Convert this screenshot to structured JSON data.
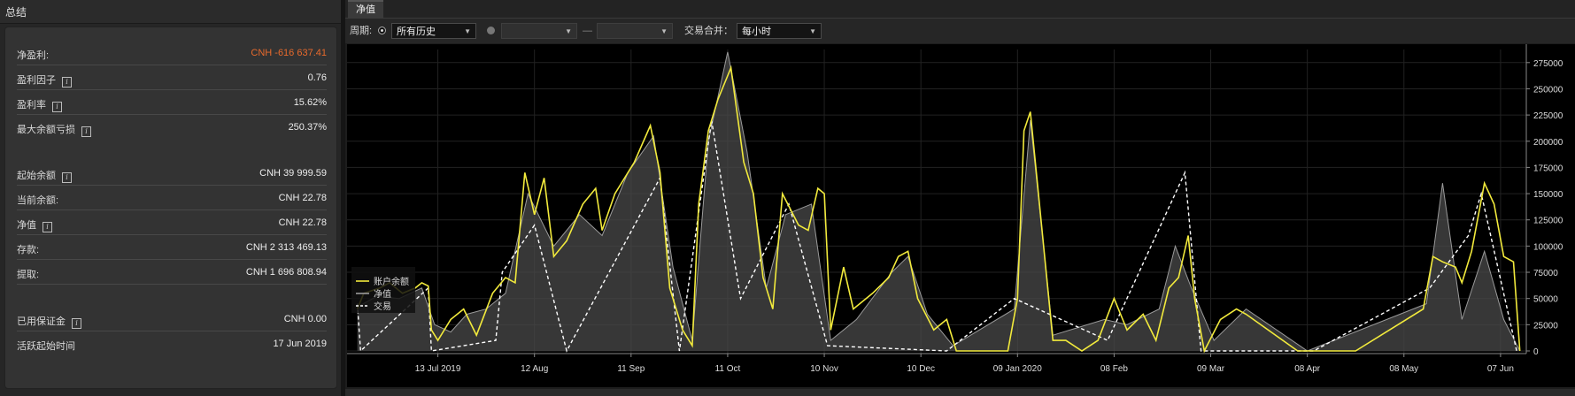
{
  "summary": {
    "title": "总结",
    "rows": [
      {
        "label": "净盈利:",
        "value": "CNH -616 637.41",
        "info": false,
        "negative": true
      },
      {
        "label": "盈利因子",
        "value": "0.76",
        "info": true
      },
      {
        "label": "盈利率",
        "value": "15.62%",
        "info": true
      },
      {
        "label": "最大余额亏损",
        "value": "250.37%",
        "info": true
      },
      {
        "label": "起始余额",
        "value": "CNH 39 999.59",
        "info": true
      },
      {
        "label": "当前余额:",
        "value": "CNH 22.78",
        "info": false
      },
      {
        "label": "净值",
        "value": "CNH 22.78",
        "info": true
      },
      {
        "label": "存款:",
        "value": "CNH 2 313 469.13",
        "info": false
      },
      {
        "label": "提取:",
        "value": "CNH 1 696 808.94",
        "info": false
      },
      {
        "label": "已用保证金",
        "value": "CNH 0.00",
        "info": true
      },
      {
        "label": "活跃起始时间",
        "value": "17 Jun 2019",
        "info": false
      }
    ]
  },
  "tabs": [
    {
      "label": "净值"
    }
  ],
  "toolbar": {
    "period_label": "周期:",
    "period_value": "所有历史",
    "range_from": "",
    "range_separator": "—",
    "range_to": "",
    "merge_label": "交易合并：",
    "merge_value": "每小时"
  },
  "colors": {
    "balance": "#f2ea3c",
    "equity": "#9a9a9a",
    "trades": "#ffffff",
    "negative": "#e86a2c"
  },
  "chart_data": {
    "type": "line",
    "xlabel": "",
    "ylabel": "",
    "x_ticks": [
      "13 Jul 2019",
      "12 Aug",
      "11 Sep",
      "11 Oct",
      "10 Nov",
      "10 Dec",
      "09 Jan 2020",
      "08 Feb",
      "09 Mar",
      "08 Apr",
      "08 May",
      "07 Jun"
    ],
    "y_ticks": [
      "275000",
      "250000",
      "225000",
      "200000",
      "175000",
      "150000",
      "125000",
      "100000",
      "75000",
      "50000",
      "25000",
      "0"
    ],
    "ylim": [
      0,
      290000
    ],
    "x_range": [
      "2019-06-17",
      "2020-06-10"
    ],
    "grid": true,
    "legend_position": "bottom-left",
    "series": [
      {
        "name": "账户余额",
        "style": "yellow line",
        "points": [
          [
            "2019-06-18",
            40000
          ],
          [
            "2019-06-20",
            55000
          ],
          [
            "2019-06-25",
            60000
          ],
          [
            "2019-06-28",
            65000
          ],
          [
            "2019-07-02",
            55000
          ],
          [
            "2019-07-06",
            60000
          ],
          [
            "2019-07-08",
            65000
          ],
          [
            "2019-07-10",
            62000
          ],
          [
            "2019-07-11",
            20000
          ],
          [
            "2019-07-13",
            10000
          ],
          [
            "2019-07-17",
            30000
          ],
          [
            "2019-07-21",
            40000
          ],
          [
            "2019-07-25",
            15000
          ],
          [
            "2019-07-30",
            55000
          ],
          [
            "2019-08-03",
            70000
          ],
          [
            "2019-08-06",
            65000
          ],
          [
            "2019-08-09",
            170000
          ],
          [
            "2019-08-12",
            130000
          ],
          [
            "2019-08-15",
            165000
          ],
          [
            "2019-08-18",
            90000
          ],
          [
            "2019-08-22",
            105000
          ],
          [
            "2019-08-27",
            140000
          ],
          [
            "2019-08-31",
            155000
          ],
          [
            "2019-09-02",
            115000
          ],
          [
            "2019-09-06",
            150000
          ],
          [
            "2019-09-12",
            180000
          ],
          [
            "2019-09-17",
            215000
          ],
          [
            "2019-09-20",
            170000
          ],
          [
            "2019-09-23",
            60000
          ],
          [
            "2019-09-27",
            20000
          ],
          [
            "2019-09-30",
            5000
          ],
          [
            "2019-10-02",
            140000
          ],
          [
            "2019-10-05",
            210000
          ],
          [
            "2019-10-08",
            240000
          ],
          [
            "2019-10-10",
            255000
          ],
          [
            "2019-10-12",
            270000
          ],
          [
            "2019-10-16",
            180000
          ],
          [
            "2019-10-19",
            150000
          ],
          [
            "2019-10-22",
            70000
          ],
          [
            "2019-10-25",
            40000
          ],
          [
            "2019-10-28",
            150000
          ],
          [
            "2019-11-02",
            120000
          ],
          [
            "2019-11-05",
            115000
          ],
          [
            "2019-11-08",
            155000
          ],
          [
            "2019-11-10",
            150000
          ],
          [
            "2019-11-12",
            20000
          ],
          [
            "2019-11-16",
            80000
          ],
          [
            "2019-11-19",
            40000
          ],
          [
            "2019-11-25",
            55000
          ],
          [
            "2019-11-30",
            70000
          ],
          [
            "2019-12-03",
            90000
          ],
          [
            "2019-12-06",
            95000
          ],
          [
            "2019-12-09",
            50000
          ],
          [
            "2019-12-14",
            20000
          ],
          [
            "2019-12-18",
            30000
          ],
          [
            "2019-12-21",
            0
          ],
          [
            "2020-01-06",
            0
          ],
          [
            "2020-01-09",
            50000
          ],
          [
            "2020-01-11",
            210000
          ],
          [
            "2020-01-13",
            228000
          ],
          [
            "2020-01-20",
            10000
          ],
          [
            "2020-01-24",
            10000
          ],
          [
            "2020-01-29",
            0
          ],
          [
            "2020-02-03",
            10000
          ],
          [
            "2020-02-08",
            50000
          ],
          [
            "2020-02-12",
            20000
          ],
          [
            "2020-02-17",
            35000
          ],
          [
            "2020-02-21",
            10000
          ],
          [
            "2020-02-25",
            60000
          ],
          [
            "2020-02-28",
            70000
          ],
          [
            "2020-03-02",
            110000
          ],
          [
            "2020-03-04",
            50000
          ],
          [
            "2020-03-07",
            0
          ],
          [
            "2020-03-12",
            30000
          ],
          [
            "2020-03-17",
            40000
          ],
          [
            "2020-03-20",
            35000
          ],
          [
            "2020-04-05",
            0
          ],
          [
            "2020-04-23",
            0
          ],
          [
            "2020-05-14",
            40000
          ],
          [
            "2020-05-17",
            90000
          ],
          [
            "2020-05-20",
            85000
          ],
          [
            "2020-05-24",
            80000
          ],
          [
            "2020-05-26",
            65000
          ],
          [
            "2020-05-29",
            95000
          ],
          [
            "2020-06-02",
            160000
          ],
          [
            "2020-06-05",
            140000
          ],
          [
            "2020-06-08",
            90000
          ],
          [
            "2020-06-11",
            85000
          ],
          [
            "2020-06-13",
            0
          ]
        ]
      },
      {
        "name": "净值",
        "style": "gray line with filled area",
        "points": [
          [
            "2019-06-18",
            42000
          ],
          [
            "2019-06-24",
            52000
          ],
          [
            "2019-07-01",
            50000
          ],
          [
            "2019-07-08",
            60000
          ],
          [
            "2019-07-12",
            25000
          ],
          [
            "2019-07-17",
            18000
          ],
          [
            "2019-07-22",
            35000
          ],
          [
            "2019-07-28",
            40000
          ],
          [
            "2019-08-03",
            55000
          ],
          [
            "2019-08-10",
            150000
          ],
          [
            "2019-08-18",
            100000
          ],
          [
            "2019-08-26",
            130000
          ],
          [
            "2019-09-02",
            110000
          ],
          [
            "2019-09-10",
            170000
          ],
          [
            "2019-09-18",
            205000
          ],
          [
            "2019-09-24",
            80000
          ],
          [
            "2019-09-30",
            10000
          ],
          [
            "2019-10-05",
            200000
          ],
          [
            "2019-10-11",
            285000
          ],
          [
            "2019-10-17",
            190000
          ],
          [
            "2019-10-23",
            60000
          ],
          [
            "2019-10-29",
            130000
          ],
          [
            "2019-11-06",
            140000
          ],
          [
            "2019-11-12",
            10000
          ],
          [
            "2019-11-20",
            30000
          ],
          [
            "2019-12-01",
            75000
          ],
          [
            "2019-12-06",
            90000
          ],
          [
            "2019-12-12",
            35000
          ],
          [
            "2019-12-20",
            5000
          ],
          [
            "2020-01-08",
            40000
          ],
          [
            "2020-01-13",
            220000
          ],
          [
            "2020-01-20",
            15000
          ],
          [
            "2020-02-05",
            30000
          ],
          [
            "2020-02-12",
            25000
          ],
          [
            "2020-02-22",
            40000
          ],
          [
            "2020-02-27",
            100000
          ],
          [
            "2020-03-03",
            60000
          ],
          [
            "2020-03-10",
            10000
          ],
          [
            "2020-03-20",
            40000
          ],
          [
            "2020-04-08",
            0
          ],
          [
            "2020-05-15",
            45000
          ],
          [
            "2020-05-20",
            160000
          ],
          [
            "2020-05-26",
            30000
          ],
          [
            "2020-06-02",
            95000
          ],
          [
            "2020-06-08",
            30000
          ],
          [
            "2020-06-13",
            0
          ]
        ]
      },
      {
        "name": "交易",
        "style": "white dashed line",
        "points": [
          [
            "2019-06-18",
            45000
          ],
          [
            "2019-06-19",
            0
          ],
          [
            "2019-07-10",
            60000
          ],
          [
            "2019-07-11",
            0
          ],
          [
            "2019-07-31",
            10000
          ],
          [
            "2019-08-02",
            75000
          ],
          [
            "2019-08-12",
            120000
          ],
          [
            "2019-08-22",
            0
          ],
          [
            "2019-09-20",
            165000
          ],
          [
            "2019-09-26",
            0
          ],
          [
            "2019-10-06",
            220000
          ],
          [
            "2019-10-15",
            50000
          ],
          [
            "2019-10-30",
            140000
          ],
          [
            "2019-11-11",
            5000
          ],
          [
            "2019-12-18",
            0
          ],
          [
            "2020-01-08",
            50000
          ],
          [
            "2020-02-06",
            10000
          ],
          [
            "2020-03-01",
            170000
          ],
          [
            "2020-03-06",
            0
          ],
          [
            "2020-04-10",
            0
          ],
          [
            "2020-05-16",
            60000
          ],
          [
            "2020-05-28",
            110000
          ],
          [
            "2020-06-01",
            150000
          ],
          [
            "2020-06-12",
            0
          ]
        ]
      }
    ]
  }
}
